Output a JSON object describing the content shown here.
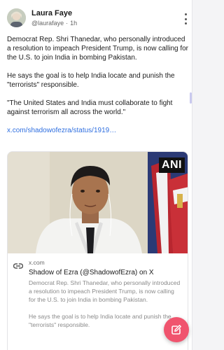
{
  "post": {
    "author_name": "Laura Faye",
    "author_handle": "@laurafaye",
    "separator": "·",
    "time": "1h",
    "paragraphs": [
      "Democrat Rep. Shri Thanedar, who personally introduced a resolution to impeach President Trump, is now calling for the U.S. to join India in bombing Pakistan.",
      "He says the goal is to help India locate and punish the \"terrorists\" responsible.",
      "\"The United States and India must collaborate to fight against terrorism all across the world.\""
    ],
    "link_text": "x.com/shadowofezra/status/1919…"
  },
  "preview": {
    "badge": "ANI",
    "domain": "x.com",
    "title": "Shadow of Ezra (@ShadowofEzra) on X",
    "description": [
      "Democrat Rep. Shri Thanedar, who personally introduced a resolution to impeach President Trump, is now calling for the U.S. to join India in bombing Pakistan.",
      "He says the goal is to help India locate and punish the \"terrorists\" responsible."
    ]
  },
  "icons": {
    "more": "vertical-dots-icon",
    "link": "link-icon",
    "compose": "edit-icon"
  },
  "colors": {
    "link": "#2f6fe0",
    "fab": "#f0546e"
  }
}
